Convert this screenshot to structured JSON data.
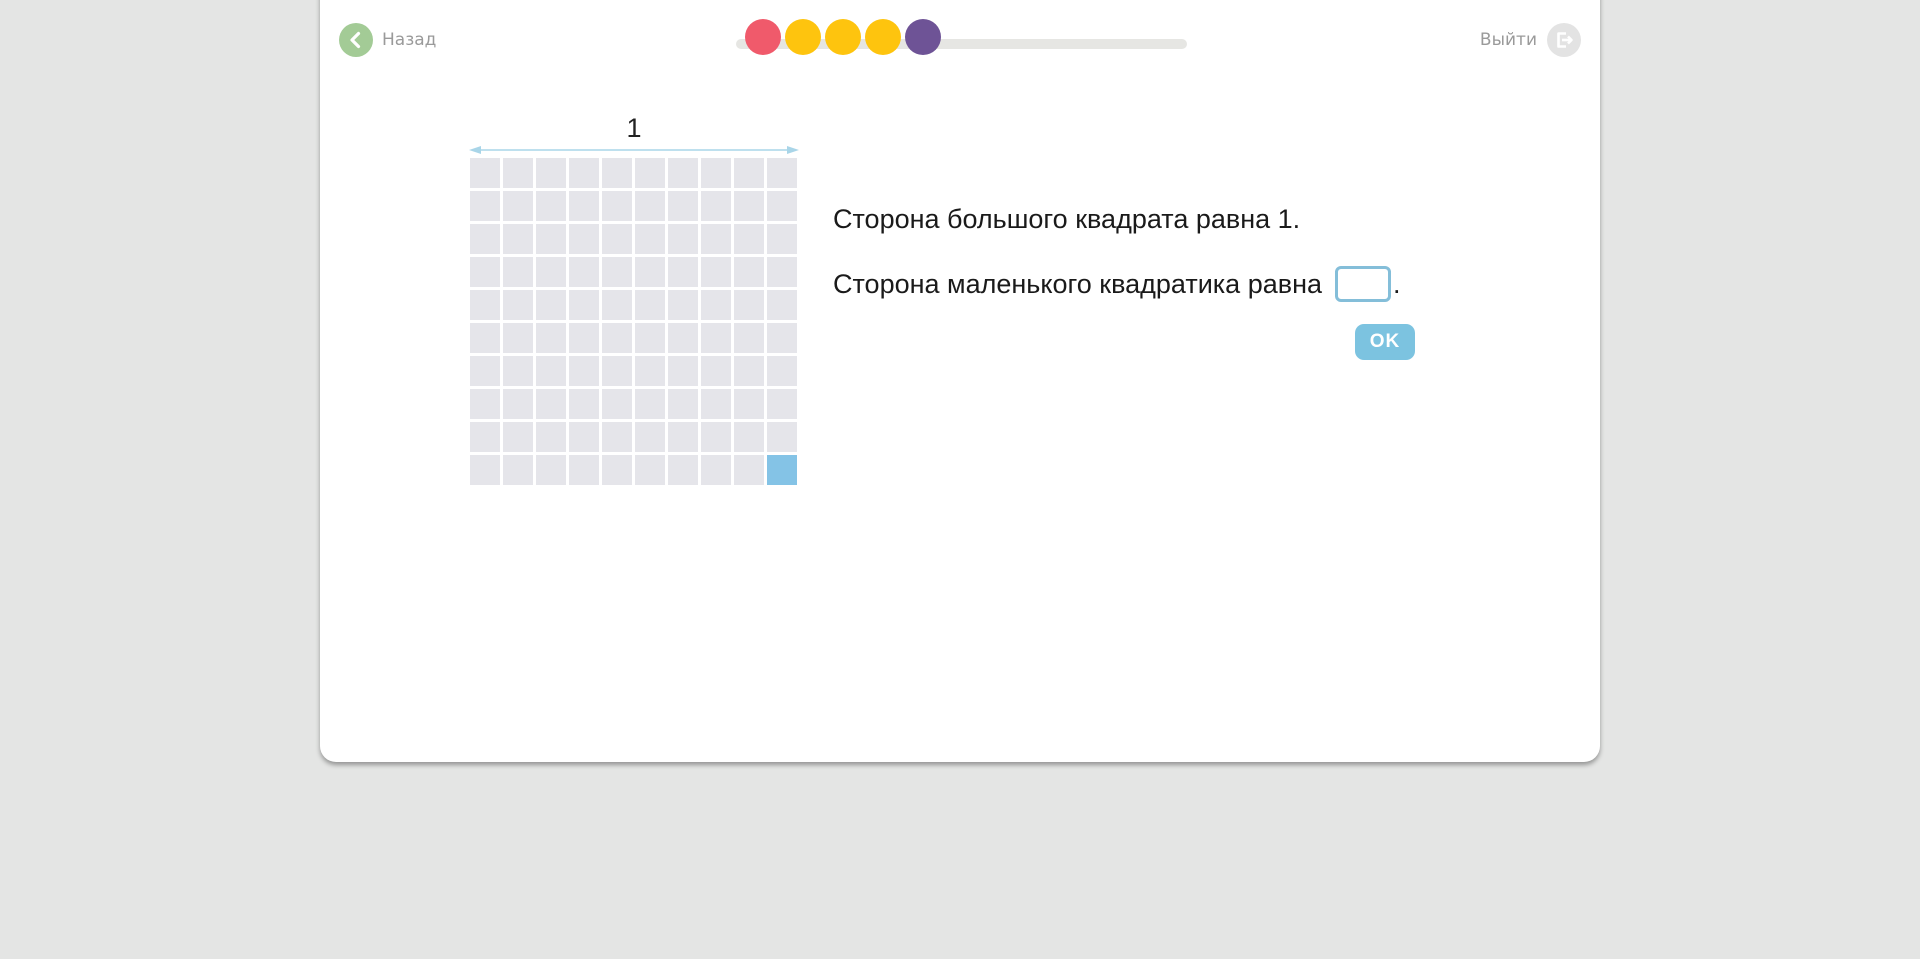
{
  "nav": {
    "back_label": "Назад",
    "exit_label": "Выйти"
  },
  "progress": {
    "steps": [
      {
        "state": "wrong",
        "color": "#f05a6b"
      },
      {
        "state": "correct",
        "color": "#fec40e"
      },
      {
        "state": "correct",
        "color": "#fec40e"
      },
      {
        "state": "correct",
        "color": "#fec40e"
      },
      {
        "state": "current",
        "color": "#6e5396"
      }
    ]
  },
  "figure": {
    "side_label": "1",
    "grid_rows": 10,
    "grid_cols": 10,
    "highlighted_cell": {
      "row": 10,
      "col": 10
    },
    "cell_color": "#e5e5ea",
    "highlight_color": "#84c3e6",
    "arrow_color": "#a9d5e8"
  },
  "task": {
    "line1": "Сторона большого квадрата равна 1.",
    "line2": "Сторона маленького квадратика равна",
    "line2_end": ".",
    "answer_value": "",
    "ok_label": "OK"
  },
  "colors": {
    "background": "#e4e5e4",
    "card": "#ffffff",
    "back_icon_bg": "#a3cb96",
    "exit_icon_bg": "#e3e3e3",
    "ok_bg": "#7cc3e0",
    "input_border": "#84bed9"
  },
  "icons": {
    "back": "chevron-left-icon",
    "exit": "exit-door-icon"
  }
}
